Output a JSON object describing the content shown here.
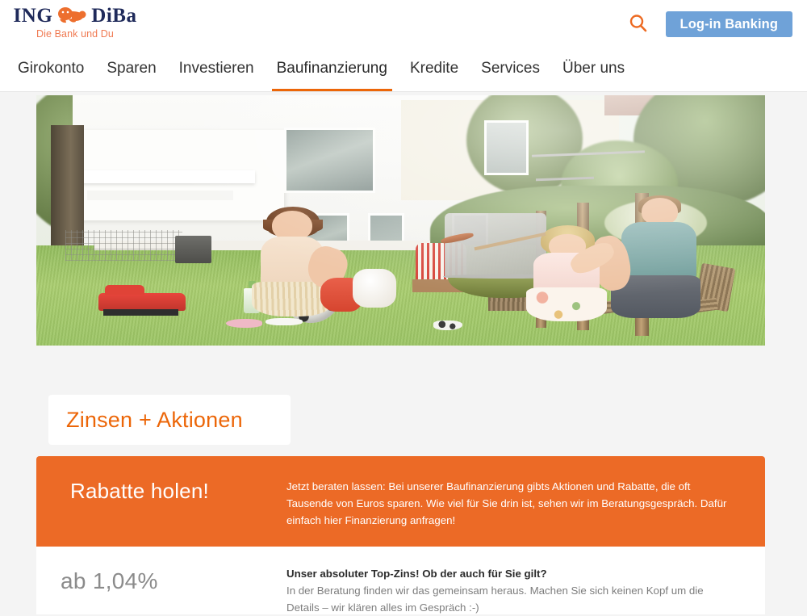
{
  "brand": {
    "logo_ing": "ING",
    "logo_diba": "DiBa",
    "lion_icon": "lion-icon",
    "tagline": "Die Bank und Du",
    "navy": "#1f2a5a",
    "orange": "#ec6608",
    "banner_orange": "#ec6a26",
    "login_blue": "#6fa2d8"
  },
  "header": {
    "search_icon": "search-icon",
    "login_label": "Log-in Banking"
  },
  "nav": {
    "items": [
      {
        "label": "Girokonto",
        "active": false
      },
      {
        "label": "Sparen",
        "active": false
      },
      {
        "label": "Investieren",
        "active": false
      },
      {
        "label": "Baufinanzierung",
        "active": true
      },
      {
        "label": "Kredite",
        "active": false
      },
      {
        "label": "Services",
        "active": false
      },
      {
        "label": "Über uns",
        "active": false
      }
    ]
  },
  "hero": {
    "caption": "Zinsen + Aktionen",
    "photo_alt": "Familie mit zwei Kindern grillt im Garten vor einem modernen weißen Haus"
  },
  "promo": {
    "title": "Rabatte holen!",
    "body": "Jetzt beraten lassen: Bei unserer Baufinanzierung gibts Aktionen und Rabatte, die oft Tausende von Euros sparen. Wie viel für Sie drin ist, sehen wir im Beratungsgespräch. Dafür einfach hier Finanzierung anfragen!"
  },
  "info": {
    "rate": "ab 1,04%",
    "heading": "Unser absoluter Top-Zins! Ob der auch für Sie gilt?",
    "body": "In der Beratung finden wir das gemeinsam heraus. Machen Sie sich keinen Kopf um die Details – wir klären alles im Gespräch :-)"
  }
}
